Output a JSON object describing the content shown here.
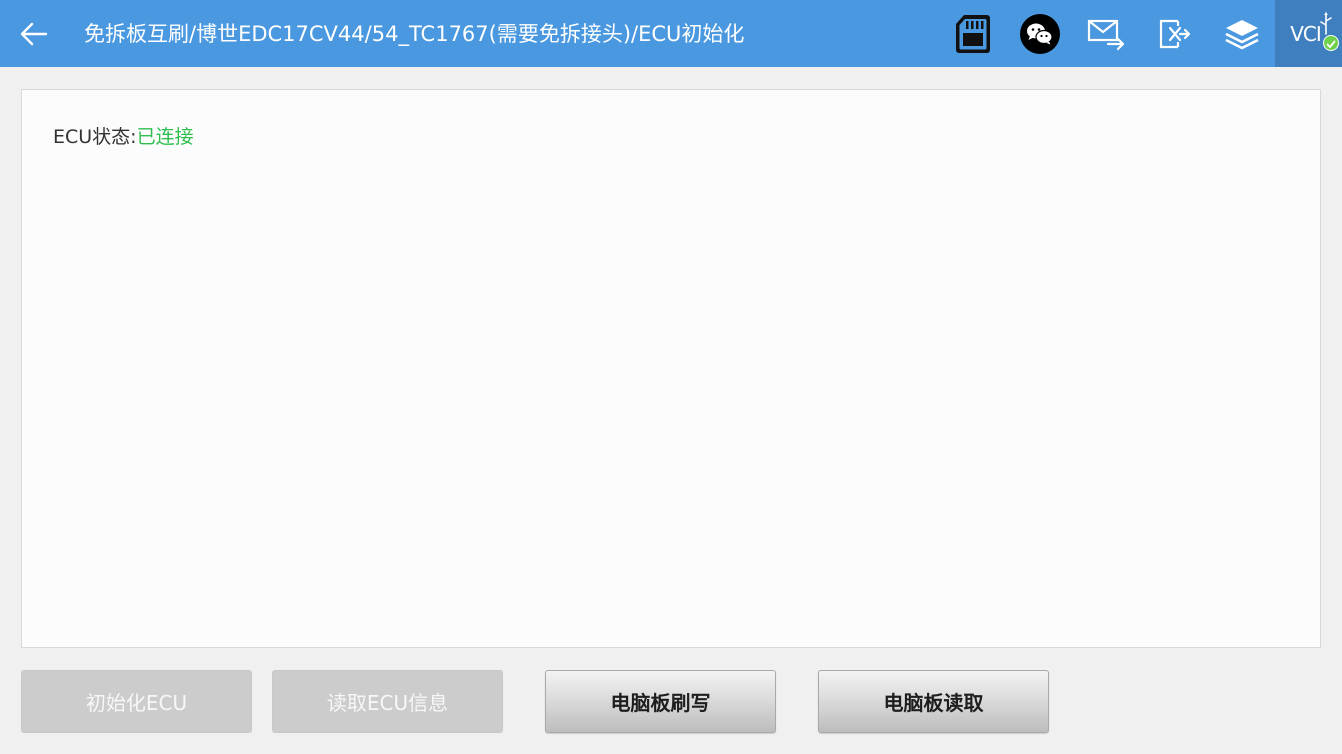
{
  "header": {
    "title": "免拆板互刷/博世EDC17CV44/54_TC1767(需要免拆接头)/ECU初始化",
    "vci_label": "VCI",
    "accent_color": "#4a98e0"
  },
  "icons": {
    "back": "back-arrow-icon",
    "sd_card": "sd-card-icon",
    "wechat": "wechat-icon",
    "mail": "mail-forward-icon",
    "exit": "exit-icon",
    "layers": "layers-icon",
    "usb": "usb-icon",
    "connected": "check-icon"
  },
  "panel": {
    "status_label": "ECU状态:",
    "status_value": "已连接",
    "status_color": "#2fbf4f"
  },
  "buttons": [
    {
      "label": "初始化ECU",
      "enabled": false
    },
    {
      "label": "读取ECU信息",
      "enabled": false
    },
    {
      "label": "电脑板刷写",
      "enabled": true
    },
    {
      "label": "电脑板读取",
      "enabled": true
    }
  ]
}
